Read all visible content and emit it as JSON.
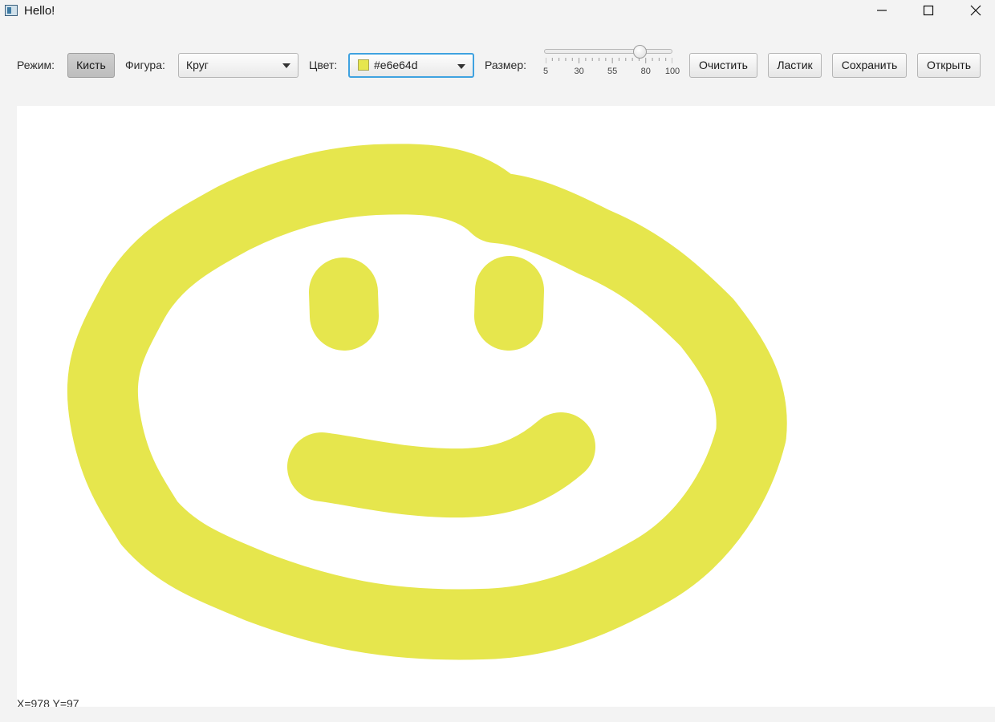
{
  "window": {
    "title": "Hello!",
    "controls": [
      "minimize",
      "maximize",
      "close"
    ]
  },
  "toolbar": {
    "mode_label": "Режим:",
    "mode_button": "Кисть",
    "shape_label": "Фигура:",
    "shape_value": "Круг",
    "color_label": "Цвет:",
    "color_value": "#e6e64d",
    "size_label": "Размер:",
    "size_slider": {
      "min": 5,
      "max": 100,
      "value": 76,
      "tick_labels": [
        "5",
        "30",
        "55",
        "80",
        "100"
      ]
    },
    "clear_button": "Очистить",
    "eraser_button": "Ластик",
    "save_button": "Сохранить",
    "open_button": "Открыть"
  },
  "canvas": {
    "background": "#ffffff",
    "brush_color": "#e6e64d"
  },
  "status": {
    "coords": "X=978 Y=97"
  },
  "icons": {
    "app": "app-window-icon",
    "minimize": "minimize-icon",
    "maximize": "maximize-icon",
    "close": "close-icon",
    "dropdown": "chevron-down-icon"
  }
}
